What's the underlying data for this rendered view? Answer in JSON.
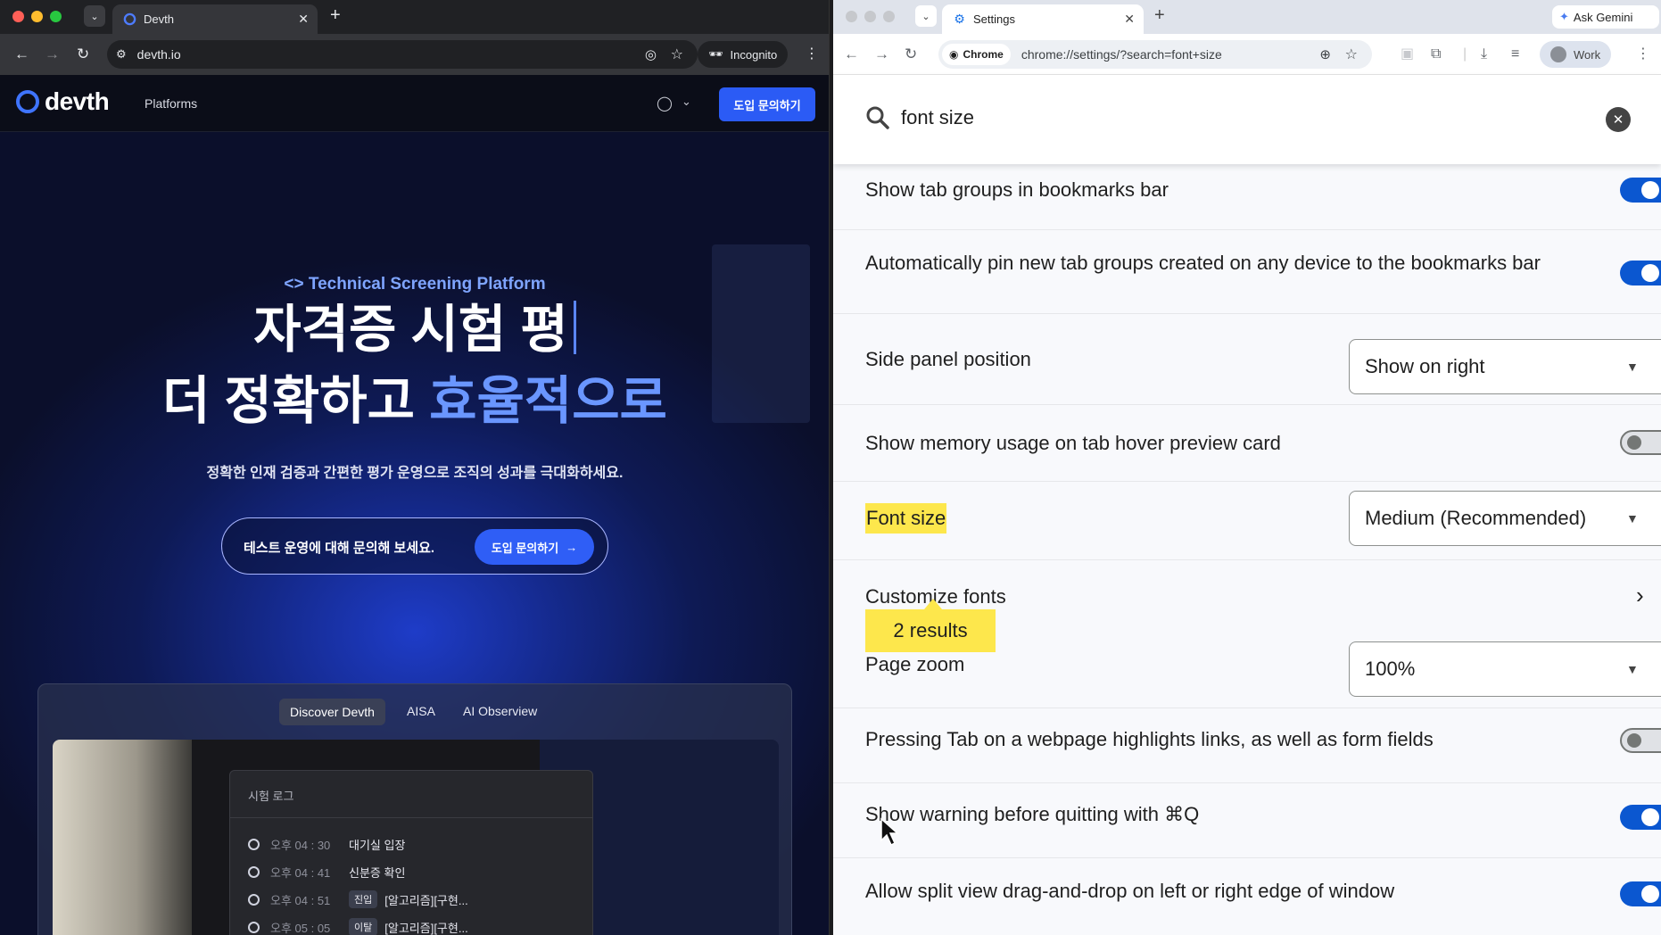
{
  "left_window": {
    "tab": {
      "title": "Devth"
    },
    "url": "devth.io",
    "incognito_label": "Incognito",
    "site": {
      "logo_text": "devth",
      "nav_platforms": "Platforms",
      "cta": "도입 문의하기",
      "eyebrow": "Technical Screening Platform",
      "headline_line1": "자격증 시험 평",
      "headline_line2_white": "더 정확하고 ",
      "headline_line2_blue": "효율적으로",
      "subtitle": "정확한 인재 검증과 간편한 평가 운영으로 조직의 성과를 극대화하세요.",
      "inquiry_text": "테스트 운영에 대해 문의해 보세요.",
      "inquiry_button": "도입 문의하기",
      "tabs": [
        "Discover Devth",
        "AISA",
        "AI Obserview"
      ],
      "log_title": "시험 로그",
      "log_rows": [
        {
          "time": "오후 04 : 30",
          "tag": "",
          "text": "대기실 입장"
        },
        {
          "time": "오후 04 : 41",
          "tag": "",
          "text": "신분증 확인"
        },
        {
          "time": "오후 04 : 51",
          "tag": "진입",
          "text": "[알고리즘][구현..."
        },
        {
          "time": "오후 05 : 05",
          "tag": "이탈",
          "text": "[알고리즘][구현..."
        }
      ]
    }
  },
  "right_window": {
    "tab": {
      "title": "Settings"
    },
    "ask_gemini": "Ask Gemini",
    "chrome_chip": "Chrome",
    "url": "chrome://settings/?search=font+size",
    "profile": "Work",
    "search": {
      "query": "font size"
    },
    "results_badge": "2 results",
    "settings": {
      "tab_groups_bookmarks": "Show tab groups in bookmarks bar",
      "auto_pin": "Automatically pin new tab groups created on any device to the bookmarks bar",
      "side_panel_label": "Side panel position",
      "side_panel_value": "Show on right",
      "memory_usage": "Show memory usage on tab hover preview card",
      "font_size_label": "Font size",
      "font_size_value": "Medium (Recommended)",
      "customize_fonts": "Customize fonts",
      "page_zoom_label": "Page zoom",
      "page_zoom_value": "100%",
      "tab_highlights": "Pressing Tab on a webpage highlights links, as well as form fields",
      "warn_quit": "Show warning before quitting with ⌘Q",
      "split_view": "Allow split view drag-and-drop on left or right edge of window"
    },
    "toggles": {
      "tab_groups_bookmarks": true,
      "auto_pin": true,
      "memory_usage": false,
      "tab_highlights": false,
      "warn_quit": true,
      "split_view": true
    }
  }
}
